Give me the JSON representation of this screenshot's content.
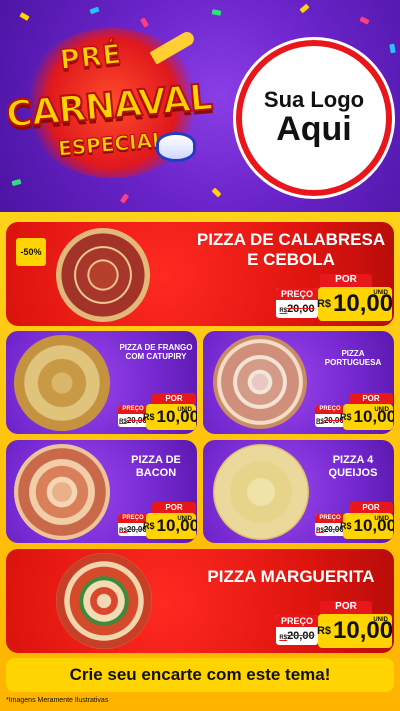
{
  "header": {
    "title_line1": "PRÉ",
    "title_line2": "CARNAVAL",
    "title_line3": "ESPECIAL",
    "logo_line1": "Sua Logo",
    "logo_line2": "Aqui"
  },
  "labels": {
    "por": "POR",
    "preco": "PREÇO",
    "de_prefix": "R$",
    "currency": "R$",
    "unit": "UNID"
  },
  "items": [
    {
      "name": "PIZZA DE CALABRESA E CEBOLA",
      "old": "20,00",
      "new": "10,00",
      "badge": "-50%"
    },
    {
      "name": "PIZZA DE FRANGO COM CATUPIRY",
      "old": "20,00",
      "new": "10,00"
    },
    {
      "name": "PIZZA PORTUGUESA",
      "old": "20,00",
      "new": "10,00"
    },
    {
      "name": "PIZZA DE BACON",
      "old": "20,00",
      "new": "10,00"
    },
    {
      "name": "PIZZA 4 QUEIJOS",
      "old": "20,00",
      "new": "10,00"
    },
    {
      "name": "PIZZA MARGUERITA",
      "old": "20,00",
      "new": "10,00"
    }
  ],
  "cta": "Crie seu encarte com este tema!",
  "disclaimer": "*Imagens Meramente Ilustrativas",
  "colors": {
    "red": "#e8171b",
    "yellow": "#ffd400",
    "purple": "#7428cf"
  }
}
